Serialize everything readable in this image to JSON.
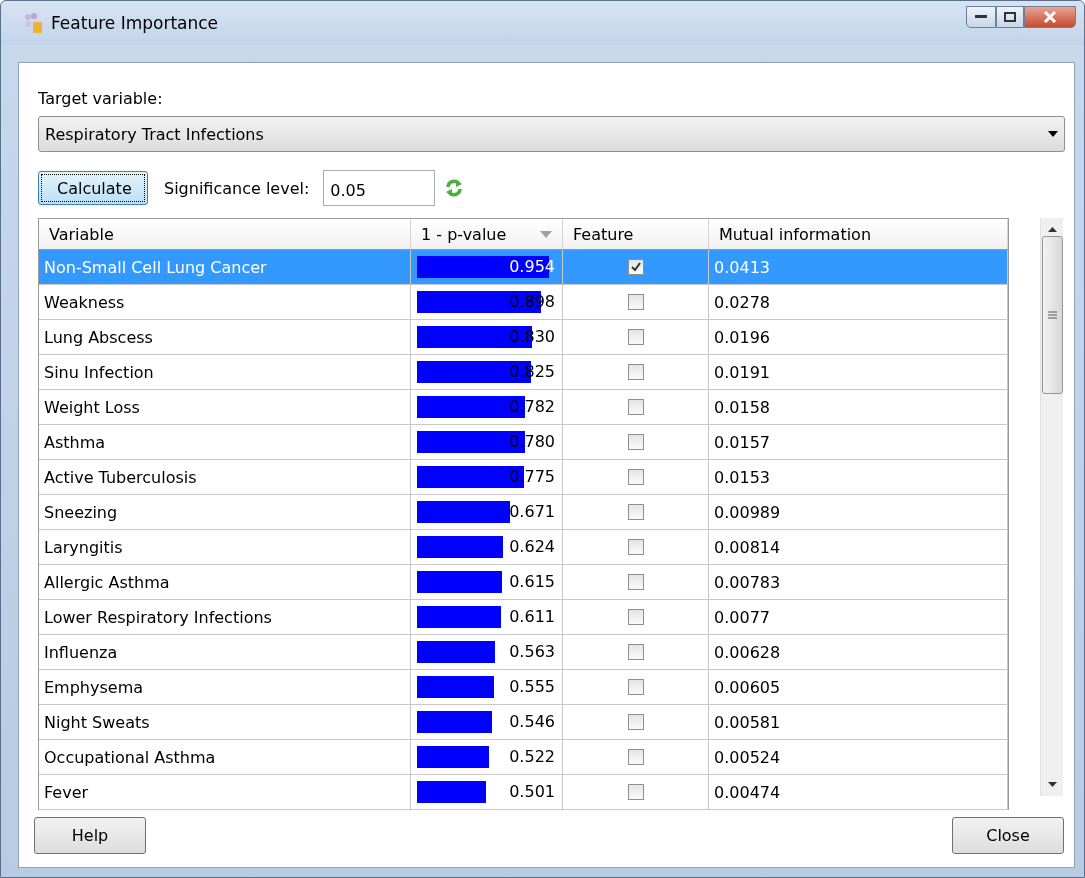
{
  "window": {
    "title": "Feature Importance"
  },
  "target": {
    "label": "Target variable:",
    "value": "Respiratory Tract Infections"
  },
  "calculate_button": "Calculate",
  "significance": {
    "label": "Significance level:",
    "value": "0.05"
  },
  "table": {
    "columns": [
      "Variable",
      "1 - p-value",
      "Feature",
      "Mutual information"
    ],
    "rows": [
      {
        "variable": "Non-Small Cell Lung Cancer",
        "p_value": "0.954",
        "level": 0.954,
        "feature": true,
        "mutual_information": "0.0413",
        "selected": true
      },
      {
        "variable": "Weakness",
        "p_value": "0.898",
        "level": 0.898,
        "feature": false,
        "mutual_information": "0.0278",
        "selected": false
      },
      {
        "variable": "Lung Abscess",
        "p_value": "0.830",
        "level": 0.83,
        "feature": false,
        "mutual_information": "0.0196",
        "selected": false
      },
      {
        "variable": "Sinu Infection",
        "p_value": "0.825",
        "level": 0.825,
        "feature": false,
        "mutual_information": "0.0191",
        "selected": false
      },
      {
        "variable": "Weight Loss",
        "p_value": "0.782",
        "level": 0.782,
        "feature": false,
        "mutual_information": "0.0158",
        "selected": false
      },
      {
        "variable": "Asthma",
        "p_value": "0.780",
        "level": 0.78,
        "feature": false,
        "mutual_information": "0.0157",
        "selected": false
      },
      {
        "variable": "Active Tuberculosis",
        "p_value": "0.775",
        "level": 0.775,
        "feature": false,
        "mutual_information": "0.0153",
        "selected": false
      },
      {
        "variable": "Sneezing",
        "p_value": "0.671",
        "level": 0.671,
        "feature": false,
        "mutual_information": "0.00989",
        "selected": false
      },
      {
        "variable": "Laryngitis",
        "p_value": "0.624",
        "level": 0.624,
        "feature": false,
        "mutual_information": "0.00814",
        "selected": false
      },
      {
        "variable": "Allergic Asthma",
        "p_value": "0.615",
        "level": 0.615,
        "feature": false,
        "mutual_information": "0.00783",
        "selected": false
      },
      {
        "variable": "Lower Respiratory Infections",
        "p_value": "0.611",
        "level": 0.611,
        "feature": false,
        "mutual_information": "0.0077",
        "selected": false
      },
      {
        "variable": "Influenza",
        "p_value": "0.563",
        "level": 0.563,
        "feature": false,
        "mutual_information": "0.00628",
        "selected": false
      },
      {
        "variable": "Emphysema",
        "p_value": "0.555",
        "level": 0.555,
        "feature": false,
        "mutual_information": "0.00605",
        "selected": false
      },
      {
        "variable": "Night Sweats",
        "p_value": "0.546",
        "level": 0.546,
        "feature": false,
        "mutual_information": "0.00581",
        "selected": false
      },
      {
        "variable": "Occupational Asthma",
        "p_value": "0.522",
        "level": 0.522,
        "feature": false,
        "mutual_information": "0.00524",
        "selected": false
      },
      {
        "variable": "Fever",
        "p_value": "0.501",
        "level": 0.501,
        "feature": false,
        "mutual_information": "0.00474",
        "selected": false
      }
    ]
  },
  "buttons": [
    "Help",
    "Close"
  ]
}
